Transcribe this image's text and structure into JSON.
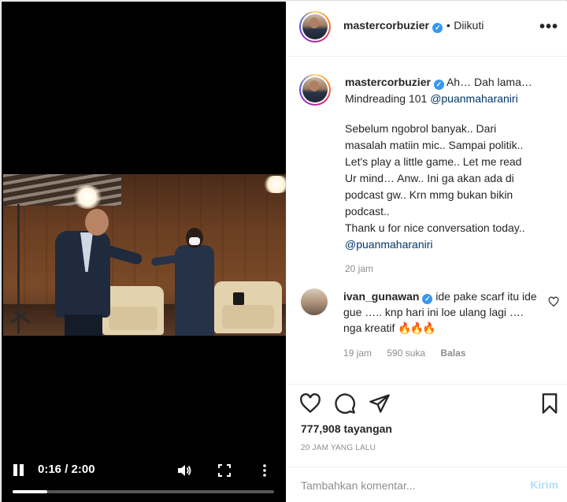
{
  "post": {
    "username": "mastercorbuzier",
    "follow_sep": "•",
    "follow_label": "Diikuti",
    "more": "•••"
  },
  "video": {
    "time": "0:16 / 2:00",
    "progress_fraction": 0.133
  },
  "caption": {
    "username": "mastercorbuzier",
    "line1": "Ah… Dah lama…",
    "line2_prefix": "Mindreading 101 ",
    "mention1": "@puanmaharaniri",
    "body": "Sebelum ngobrol banyak.. Dari\nmasalah matiin mic.. Sampai politik..\nLet's play a little game.. Let me read\nUr mind… Anw.. Ini ga akan ada di\npodcast gw.. Krn mmg bukan bikin\npodcast..\nThank u for nice conversation today..",
    "mention2": "@puanmaharaniri",
    "time": "20 jam"
  },
  "comment": {
    "username": "ivan_gunawan",
    "text": "ide pake scarf itu ide gue ….. knp hari ini loe ulang lagi …. nga kreatif",
    "emoji": "🔥🔥🔥",
    "time": "19 jam",
    "likes": "590 suka",
    "reply": "Balas"
  },
  "stats": {
    "views": "777,908 tayangan",
    "posted": "20 JAM YANG LALU"
  },
  "add_comment": {
    "placeholder": "Tambahkan komentar...",
    "post_label": "Kirim"
  },
  "colors": {
    "verified": "#3897f0",
    "mention": "#00376b",
    "post_button": "#b2dffc"
  }
}
